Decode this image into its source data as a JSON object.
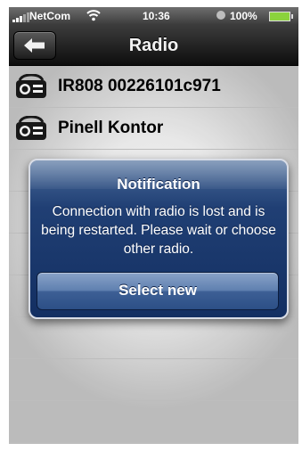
{
  "status_bar": {
    "carrier": "NetCom",
    "time": "10:36",
    "battery": "100%"
  },
  "nav": {
    "title": "Radio",
    "back_icon": "back-arrow-icon"
  },
  "radios": [
    {
      "name": "IR808 00226101c971",
      "icon": "radio-icon"
    },
    {
      "name": "Pinell Kontor",
      "icon": "radio-icon"
    }
  ],
  "alert": {
    "title": "Notification",
    "message": "Connection with radio is lost and is being restarted. Please wait or choose other radio.",
    "button_label": "Select new"
  },
  "colors": {
    "alert_bg": "#203f74",
    "battery": "#8bd33c",
    "navbar": "#1a1a1a"
  }
}
